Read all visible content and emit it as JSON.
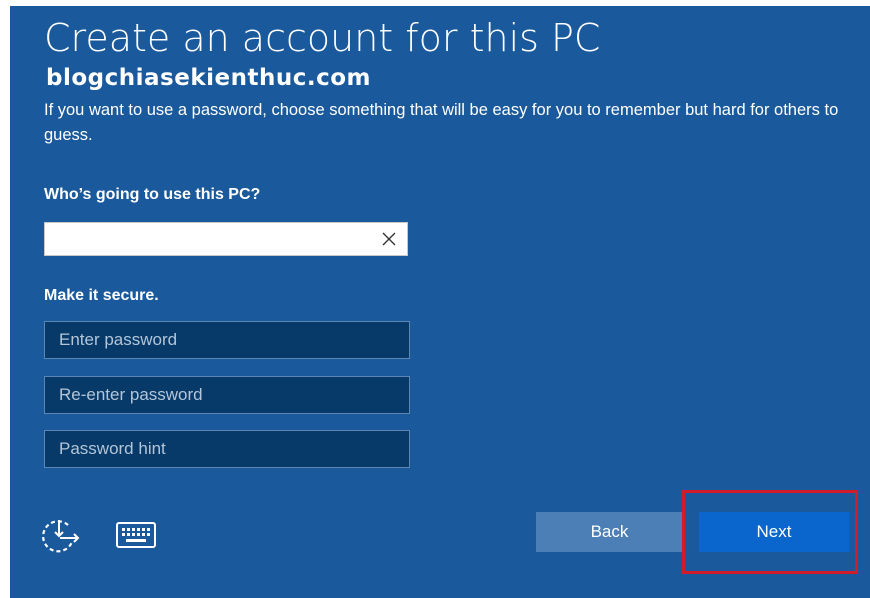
{
  "page": {
    "title": "Create an account for this PC",
    "watermark": "blogchiasekienthuc.com",
    "description": "If you want to use a password, choose something that will be easy for you to remember but hard for others to guess."
  },
  "form": {
    "user_label": "Who’s going to use this PC?",
    "user_value": "",
    "secure_label": "Make it secure.",
    "password_placeholder": "Enter password",
    "reenter_placeholder": "Re-enter password",
    "hint_placeholder": "Password hint"
  },
  "footer": {
    "back_label": "Back",
    "next_label": "Next",
    "icons": [
      "ease-of-access-icon",
      "keyboard-icon"
    ]
  },
  "colors": {
    "background": "#1a5a9c",
    "field_fill": "#073a69",
    "back_button": "#4b7fb6",
    "next_button": "#0a66cc",
    "highlight_box": "#d11c2c"
  }
}
